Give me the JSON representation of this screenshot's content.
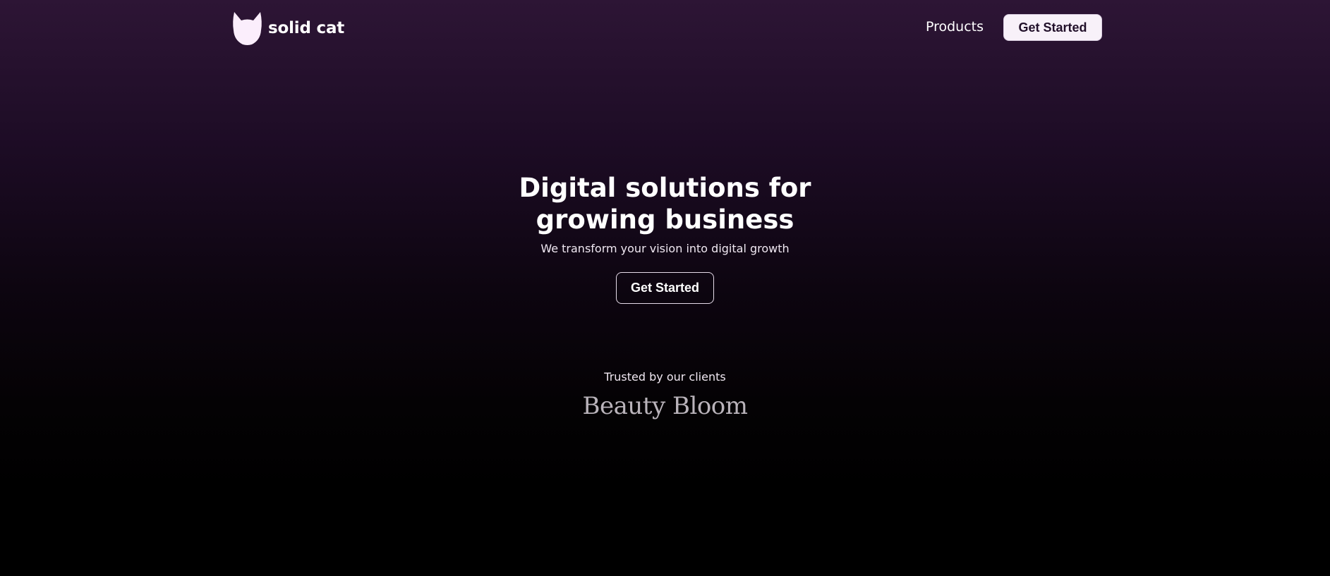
{
  "brand": {
    "name": "solid cat",
    "logo_icon": "cat-head-icon"
  },
  "nav": {
    "products_label": "Products",
    "cta_label": "Get Started"
  },
  "hero": {
    "title": "Digital solutions for growing business",
    "subtitle": "We transform your vision into digital growth",
    "cta_label": "Get Started"
  },
  "clients": {
    "heading": "Trusted by our clients",
    "logos": [
      "Beauty Bloom"
    ]
  },
  "colors": {
    "background_top": "#2d1535",
    "background_bottom": "#000000",
    "nav_button_bg": "#f8f1f9",
    "nav_button_text": "#22102a",
    "client_logo": "#b9b3ba"
  }
}
